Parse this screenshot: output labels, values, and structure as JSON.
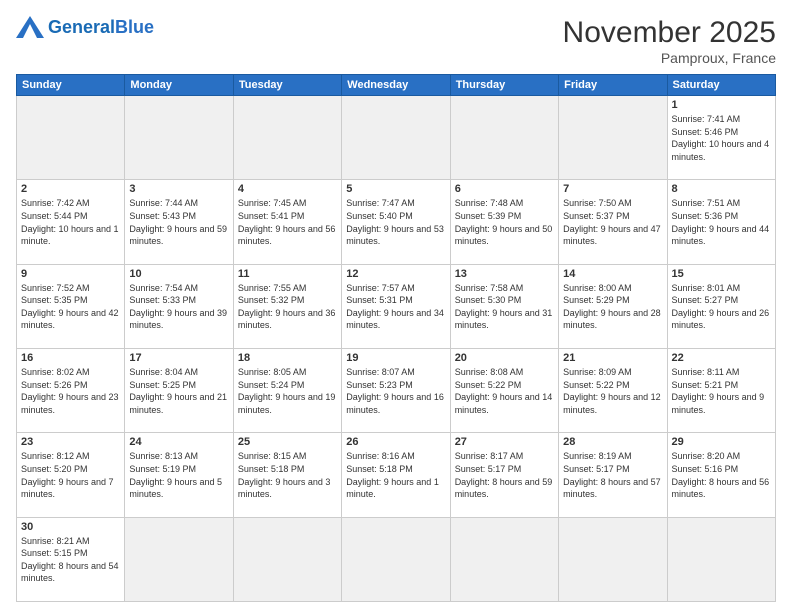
{
  "header": {
    "logo_general": "General",
    "logo_blue": "Blue",
    "month": "November 2025",
    "location": "Pamproux, France"
  },
  "days_of_week": [
    "Sunday",
    "Monday",
    "Tuesday",
    "Wednesday",
    "Thursday",
    "Friday",
    "Saturday"
  ],
  "weeks": [
    [
      {
        "day": "",
        "info": "",
        "empty": true
      },
      {
        "day": "",
        "info": "",
        "empty": true
      },
      {
        "day": "",
        "info": "",
        "empty": true
      },
      {
        "day": "",
        "info": "",
        "empty": true
      },
      {
        "day": "",
        "info": "",
        "empty": true
      },
      {
        "day": "",
        "info": "",
        "empty": true
      },
      {
        "day": "1",
        "info": "Sunrise: 7:41 AM\nSunset: 5:46 PM\nDaylight: 10 hours\nand 4 minutes."
      }
    ],
    [
      {
        "day": "2",
        "info": "Sunrise: 7:42 AM\nSunset: 5:44 PM\nDaylight: 10 hours\nand 1 minute."
      },
      {
        "day": "3",
        "info": "Sunrise: 7:44 AM\nSunset: 5:43 PM\nDaylight: 9 hours\nand 59 minutes."
      },
      {
        "day": "4",
        "info": "Sunrise: 7:45 AM\nSunset: 5:41 PM\nDaylight: 9 hours\nand 56 minutes."
      },
      {
        "day": "5",
        "info": "Sunrise: 7:47 AM\nSunset: 5:40 PM\nDaylight: 9 hours\nand 53 minutes."
      },
      {
        "day": "6",
        "info": "Sunrise: 7:48 AM\nSunset: 5:39 PM\nDaylight: 9 hours\nand 50 minutes."
      },
      {
        "day": "7",
        "info": "Sunrise: 7:50 AM\nSunset: 5:37 PM\nDaylight: 9 hours\nand 47 minutes."
      },
      {
        "day": "8",
        "info": "Sunrise: 7:51 AM\nSunset: 5:36 PM\nDaylight: 9 hours\nand 44 minutes."
      }
    ],
    [
      {
        "day": "9",
        "info": "Sunrise: 7:52 AM\nSunset: 5:35 PM\nDaylight: 9 hours\nand 42 minutes."
      },
      {
        "day": "10",
        "info": "Sunrise: 7:54 AM\nSunset: 5:33 PM\nDaylight: 9 hours\nand 39 minutes."
      },
      {
        "day": "11",
        "info": "Sunrise: 7:55 AM\nSunset: 5:32 PM\nDaylight: 9 hours\nand 36 minutes."
      },
      {
        "day": "12",
        "info": "Sunrise: 7:57 AM\nSunset: 5:31 PM\nDaylight: 9 hours\nand 34 minutes."
      },
      {
        "day": "13",
        "info": "Sunrise: 7:58 AM\nSunset: 5:30 PM\nDaylight: 9 hours\nand 31 minutes."
      },
      {
        "day": "14",
        "info": "Sunrise: 8:00 AM\nSunset: 5:29 PM\nDaylight: 9 hours\nand 28 minutes."
      },
      {
        "day": "15",
        "info": "Sunrise: 8:01 AM\nSunset: 5:27 PM\nDaylight: 9 hours\nand 26 minutes."
      }
    ],
    [
      {
        "day": "16",
        "info": "Sunrise: 8:02 AM\nSunset: 5:26 PM\nDaylight: 9 hours\nand 23 minutes."
      },
      {
        "day": "17",
        "info": "Sunrise: 8:04 AM\nSunset: 5:25 PM\nDaylight: 9 hours\nand 21 minutes."
      },
      {
        "day": "18",
        "info": "Sunrise: 8:05 AM\nSunset: 5:24 PM\nDaylight: 9 hours\nand 19 minutes."
      },
      {
        "day": "19",
        "info": "Sunrise: 8:07 AM\nSunset: 5:23 PM\nDaylight: 9 hours\nand 16 minutes."
      },
      {
        "day": "20",
        "info": "Sunrise: 8:08 AM\nSunset: 5:22 PM\nDaylight: 9 hours\nand 14 minutes."
      },
      {
        "day": "21",
        "info": "Sunrise: 8:09 AM\nSunset: 5:22 PM\nDaylight: 9 hours\nand 12 minutes."
      },
      {
        "day": "22",
        "info": "Sunrise: 8:11 AM\nSunset: 5:21 PM\nDaylight: 9 hours\nand 9 minutes."
      }
    ],
    [
      {
        "day": "23",
        "info": "Sunrise: 8:12 AM\nSunset: 5:20 PM\nDaylight: 9 hours\nand 7 minutes."
      },
      {
        "day": "24",
        "info": "Sunrise: 8:13 AM\nSunset: 5:19 PM\nDaylight: 9 hours\nand 5 minutes."
      },
      {
        "day": "25",
        "info": "Sunrise: 8:15 AM\nSunset: 5:18 PM\nDaylight: 9 hours\nand 3 minutes."
      },
      {
        "day": "26",
        "info": "Sunrise: 8:16 AM\nSunset: 5:18 PM\nDaylight: 9 hours\nand 1 minute."
      },
      {
        "day": "27",
        "info": "Sunrise: 8:17 AM\nSunset: 5:17 PM\nDaylight: 8 hours\nand 59 minutes."
      },
      {
        "day": "28",
        "info": "Sunrise: 8:19 AM\nSunset: 5:17 PM\nDaylight: 8 hours\nand 57 minutes."
      },
      {
        "day": "29",
        "info": "Sunrise: 8:20 AM\nSunset: 5:16 PM\nDaylight: 8 hours\nand 56 minutes."
      }
    ],
    [
      {
        "day": "30",
        "info": "Sunrise: 8:21 AM\nSunset: 5:15 PM\nDaylight: 8 hours\nand 54 minutes."
      },
      {
        "day": "",
        "info": "",
        "empty": true
      },
      {
        "day": "",
        "info": "",
        "empty": true
      },
      {
        "day": "",
        "info": "",
        "empty": true
      },
      {
        "day": "",
        "info": "",
        "empty": true
      },
      {
        "day": "",
        "info": "",
        "empty": true
      },
      {
        "day": "",
        "info": "",
        "empty": true
      }
    ]
  ]
}
